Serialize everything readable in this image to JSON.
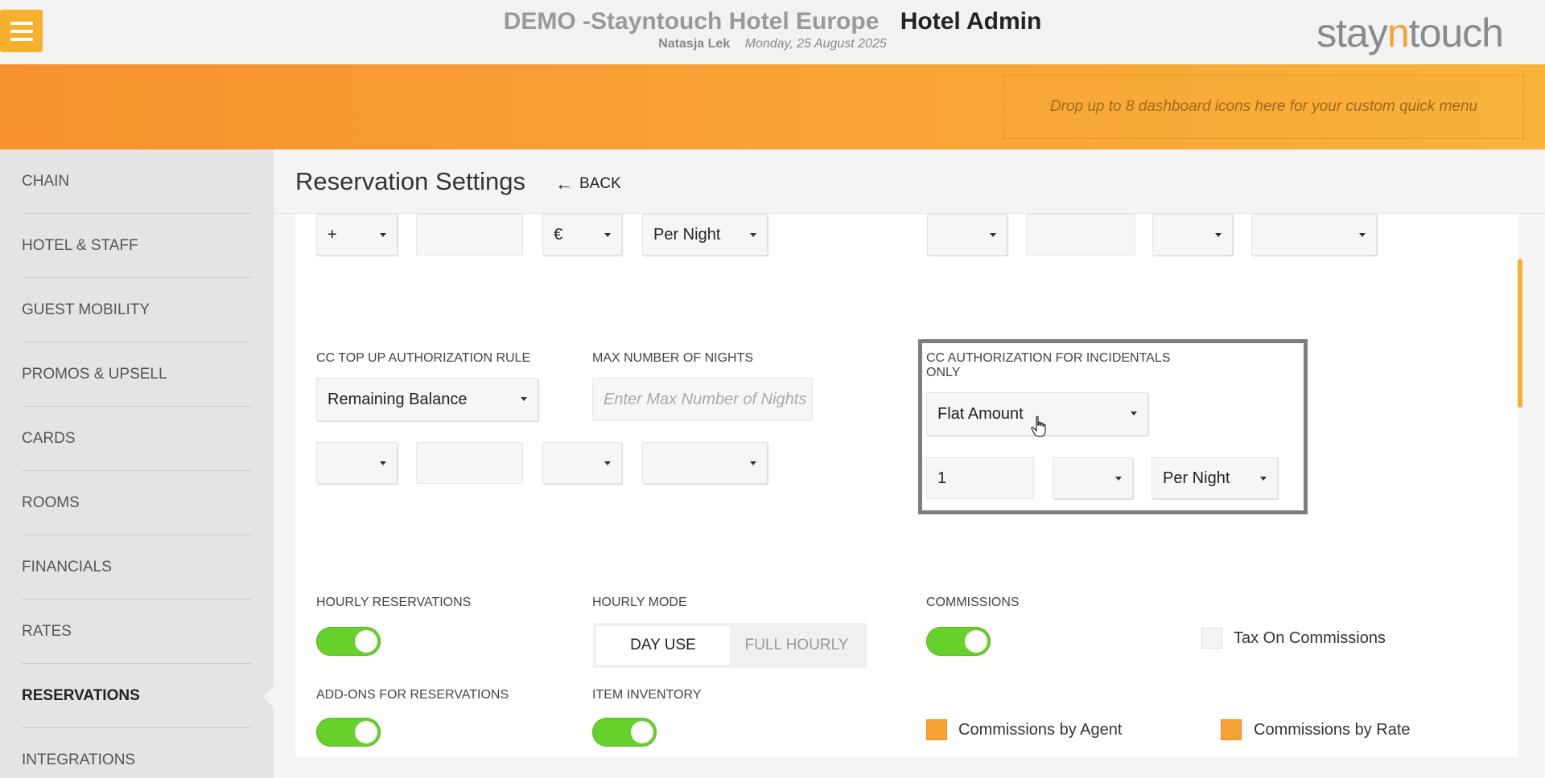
{
  "header": {
    "hotel_name": "DEMO -Stayntouch Hotel Europe",
    "app_name": "Hotel Admin",
    "user": "Natasja Lek",
    "date": "Monday, 25 August 2025",
    "logo_prefix": "stay",
    "logo_accent": "n",
    "logo_suffix": "touch",
    "menu_icon": "hamburger-menu-icon"
  },
  "quick_menu": {
    "placeholder": "Drop up to 8 dashboard icons here for your custom quick menu"
  },
  "sidebar": {
    "items": [
      {
        "label": "CHAIN"
      },
      {
        "label": "HOTEL & STAFF"
      },
      {
        "label": "GUEST MOBILITY"
      },
      {
        "label": "PROMOS & UPSELL"
      },
      {
        "label": "CARDS"
      },
      {
        "label": "ROOMS"
      },
      {
        "label": "FINANCIALS"
      },
      {
        "label": "RATES"
      },
      {
        "label": "RESERVATIONS"
      },
      {
        "label": "INTEGRATIONS"
      }
    ],
    "active": "RESERVATIONS"
  },
  "page": {
    "title": "Reservation Settings",
    "back_label": "BACK"
  },
  "row1": {
    "sign": "+",
    "amount": "",
    "currency": "€",
    "period": "Per Night",
    "right_select1": "",
    "right_input": "",
    "right_select2": "",
    "right_select3": ""
  },
  "cc_topup": {
    "label": "CC TOP UP AUTHORIZATION RULE",
    "value": "Remaining Balance",
    "sub_select1": "",
    "sub_input": "",
    "sub_select2": "",
    "sub_select3": ""
  },
  "max_nights": {
    "label": "MAX NUMBER OF NIGHTS",
    "placeholder": "Enter Max Number of Nights"
  },
  "cc_incidentals": {
    "label_line1": "CC AUTHORIZATION FOR INCIDENTALS",
    "label_line2": "ONLY",
    "value": "Flat Amount",
    "amount": "1",
    "currency": "",
    "period": "Per Night"
  },
  "hourly_reservations": {
    "label": "HOURLY RESERVATIONS",
    "enabled": true
  },
  "hourly_mode": {
    "label": "HOURLY MODE",
    "options": [
      "DAY USE",
      "FULL HOURLY"
    ],
    "selected": "DAY USE"
  },
  "commissions": {
    "label": "COMMISSIONS",
    "enabled": true
  },
  "tax_on_commissions": {
    "label": "Tax On Commissions",
    "checked": false
  },
  "addons": {
    "label": "ADD-ONS FOR RESERVATIONS",
    "enabled": true
  },
  "item_inventory": {
    "label": "ITEM INVENTORY",
    "enabled": true
  },
  "commissions_by_agent": {
    "label": "Commissions by Agent",
    "checked": true
  },
  "commissions_by_rate": {
    "label": "Commissions by Rate",
    "checked": true
  },
  "colors": {
    "accent": "#f7a234",
    "toggle_on": "#66d12a",
    "band_start": "#f7922c",
    "band_end": "#f8b23b"
  }
}
